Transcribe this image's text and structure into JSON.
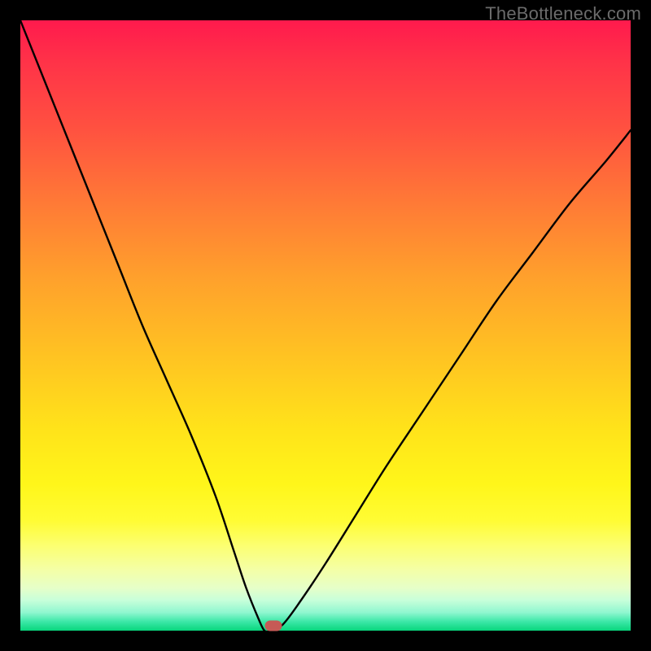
{
  "watermark": "TheBottleneck.com",
  "chart_data": {
    "type": "line",
    "title": "",
    "xlabel": "",
    "ylabel": "",
    "xlim": [
      0,
      100
    ],
    "ylim": [
      0,
      100
    ],
    "grid": false,
    "legend": false,
    "description": "Bottleneck curve on a red-to-green vertical gradient. A single black curve descends steeply from the upper-left to a minimum near x≈40 (touching the green baseline), then rises with diminishing slope toward the upper-right. A small rounded marker sits at the minimum.",
    "series": [
      {
        "name": "bottleneck-curve",
        "color": "#000000",
        "x": [
          0,
          4,
          8,
          12,
          16,
          20,
          24,
          28,
          32,
          35,
          37,
          39,
          40,
          41,
          43,
          46,
          50,
          55,
          60,
          66,
          72,
          78,
          84,
          90,
          96,
          100
        ],
        "y": [
          100,
          90,
          80,
          70,
          60,
          50,
          41,
          32,
          22,
          13,
          7,
          2,
          0,
          0,
          1,
          5,
          11,
          19,
          27,
          36,
          45,
          54,
          62,
          70,
          77,
          82
        ]
      }
    ],
    "marker": {
      "x": 41.5,
      "y": 0.8,
      "color": "#c65a56"
    },
    "gradient_stops": [
      {
        "pos": 0,
        "color": "#ff1a4d"
      },
      {
        "pos": 0.3,
        "color": "#ff7a36"
      },
      {
        "pos": 0.67,
        "color": "#ffe31a"
      },
      {
        "pos": 0.9,
        "color": "#f4ffa6"
      },
      {
        "pos": 1.0,
        "color": "#08d67d"
      }
    ]
  }
}
